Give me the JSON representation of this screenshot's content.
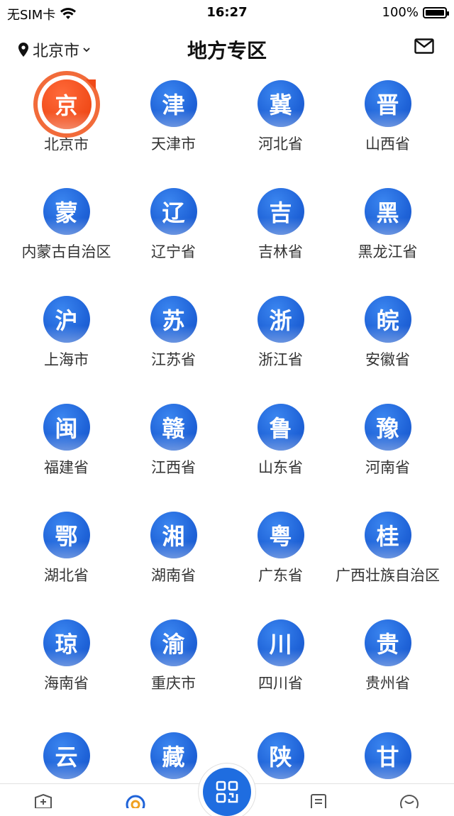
{
  "status": {
    "carrier": "无SIM卡",
    "time": "16:27",
    "battery": "100%"
  },
  "header": {
    "location": "北京市",
    "title": "地方专区"
  },
  "regions": [
    {
      "glyph": "京",
      "name": "北京市",
      "active": true
    },
    {
      "glyph": "津",
      "name": "天津市"
    },
    {
      "glyph": "冀",
      "name": "河北省"
    },
    {
      "glyph": "晋",
      "name": "山西省"
    },
    {
      "glyph": "蒙",
      "name": "内蒙古自治区"
    },
    {
      "glyph": "辽",
      "name": "辽宁省"
    },
    {
      "glyph": "吉",
      "name": "吉林省"
    },
    {
      "glyph": "黑",
      "name": "黑龙江省"
    },
    {
      "glyph": "沪",
      "name": "上海市"
    },
    {
      "glyph": "苏",
      "name": "江苏省"
    },
    {
      "glyph": "浙",
      "name": "浙江省"
    },
    {
      "glyph": "皖",
      "name": "安徽省"
    },
    {
      "glyph": "闽",
      "name": "福建省"
    },
    {
      "glyph": "赣",
      "name": "江西省"
    },
    {
      "glyph": "鲁",
      "name": "山东省"
    },
    {
      "glyph": "豫",
      "name": "河南省"
    },
    {
      "glyph": "鄂",
      "name": "湖北省"
    },
    {
      "glyph": "湘",
      "name": "湖南省"
    },
    {
      "glyph": "粤",
      "name": "广东省"
    },
    {
      "glyph": "桂",
      "name": "广西壮族自治区"
    },
    {
      "glyph": "琼",
      "name": "海南省"
    },
    {
      "glyph": "渝",
      "name": "重庆市"
    },
    {
      "glyph": "川",
      "name": "四川省"
    },
    {
      "glyph": "贵",
      "name": "贵州省"
    },
    {
      "glyph": "云",
      "name": ""
    },
    {
      "glyph": "藏",
      "name": ""
    },
    {
      "glyph": "陕",
      "name": ""
    },
    {
      "glyph": "甘",
      "name": ""
    }
  ],
  "colors": {
    "accent": "#1f63d8",
    "active": "#f04a18"
  }
}
